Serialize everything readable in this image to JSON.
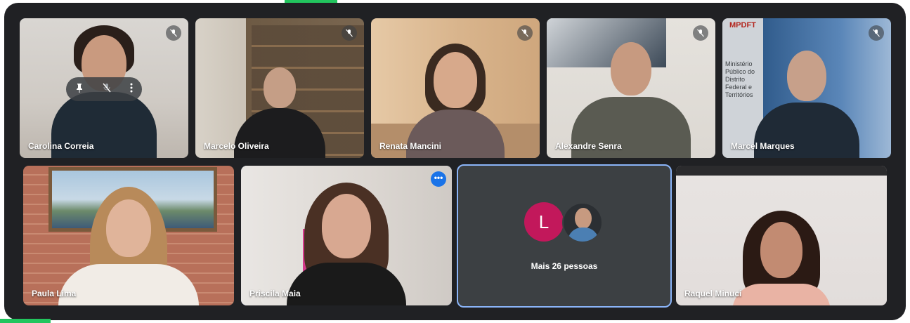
{
  "meeting": {
    "participants": [
      {
        "name": "Carolina Correia",
        "muted": true
      },
      {
        "name": "Marcelo Oliveira",
        "muted": true
      },
      {
        "name": "Renata Mancini",
        "muted": true
      },
      {
        "name": "Alexandre Senra",
        "muted": true
      },
      {
        "name": "Marcel Marques",
        "muted": true
      },
      {
        "name": "Paula Lima",
        "muted": false
      },
      {
        "name": "Priscila Maia",
        "muted": false
      },
      {
        "name": "Raquel Minuci",
        "muted": false
      }
    ],
    "others": {
      "avatar_letter": "L",
      "label": "Mais 26 pessoas"
    },
    "more_options_glyph": "•••",
    "background_text": {
      "sign_top": "MPDFT",
      "sign_side": "Ministério Público do Distrito Federal e Territórios"
    }
  },
  "colors": {
    "frame": "#202124",
    "selected_outline": "#8ab4f8",
    "avatar_l": "#c2185b",
    "more_button": "#1a73e8",
    "accent": "#22c55e"
  },
  "icons": [
    "mic-off-icon",
    "pin-icon",
    "more-vert-icon",
    "more-horiz-icon"
  ]
}
